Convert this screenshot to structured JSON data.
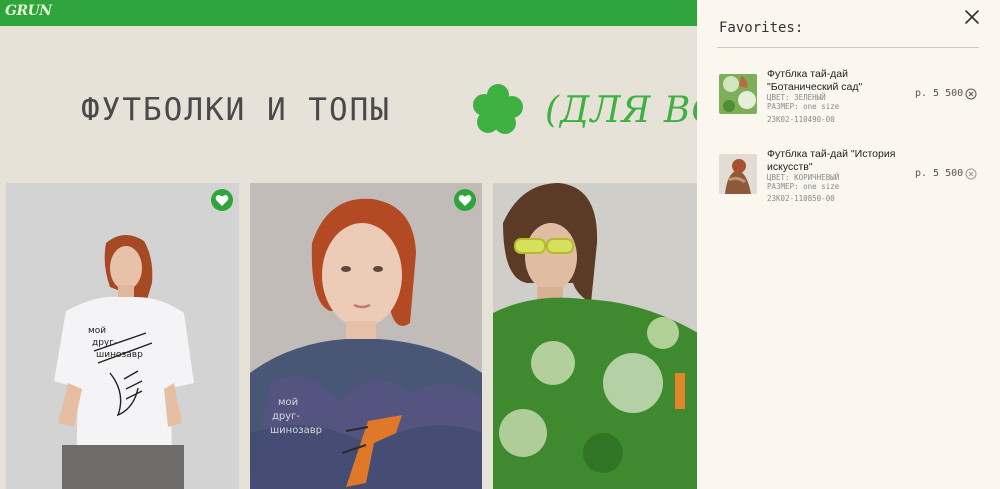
{
  "header": {
    "logo": "GRUN"
  },
  "hero": {
    "title": "ФУТБОЛКИ И ТОПЫ",
    "tagline": "(ДЛЯ ВСЕХ",
    "accent_color": "#3fb143"
  },
  "products": [
    {
      "favorite": true,
      "icon": "heart-icon"
    },
    {
      "favorite": true,
      "icon": "heart-icon"
    },
    {
      "favorite": false
    }
  ],
  "favorites": {
    "title": "Favorites:",
    "items": [
      {
        "name": "Футблка тай-дай \"Ботанический сад\"",
        "color": "ЦВЕТ: ЗЕЛЕНЫЙ",
        "size": "РАЗМЕР: one size",
        "sku": "23К02-110490-00",
        "price": "р. 5 500"
      },
      {
        "name": "Футблка тай-дай \"История искусств\"",
        "color": "ЦВЕТ: КОРИЧНЕВЫЙ",
        "size": "РАЗМЕР: one size",
        "sku": "23К02-110850-00",
        "price": "р. 5 500"
      }
    ]
  },
  "colors": {
    "brand_green": "#2ea43a",
    "background": "#e6e2d7",
    "panel": "#fbf7ee"
  }
}
